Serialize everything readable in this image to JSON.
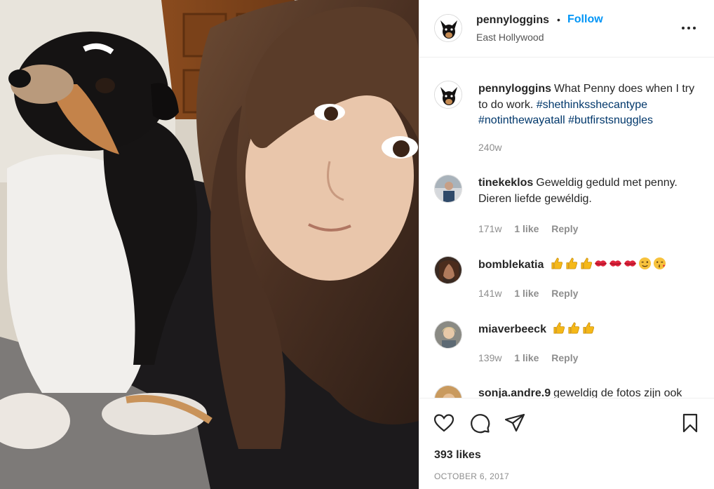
{
  "post": {
    "username": "pennyloggins",
    "follow_label": "Follow",
    "dot": "•",
    "location": "East Hollywood",
    "image_alt": "Selfie of a woman with long brown hair next to a black, tan and white dog",
    "caption": {
      "username": "pennyloggins",
      "text": "What Penny does when I try to do work.",
      "hashtags": [
        "#shethinksshecantype",
        "#notinthewayatall",
        "#butfirstsnuggles"
      ],
      "age": "240w"
    },
    "comments": [
      {
        "username": "tinekeklos",
        "text": "Geweldig geduld met penny. Dieren liefde gewéldig.",
        "age": "171w",
        "likes": "1 like",
        "reply": "Reply",
        "emojis": []
      },
      {
        "username": "bomblekatia",
        "text": "",
        "age": "141w",
        "likes": "1 like",
        "reply": "Reply",
        "emojis": [
          "thumbs-up",
          "thumbs-up",
          "thumbs-up",
          "kiss-lips",
          "kiss-lips",
          "kiss-lips",
          "wink-face",
          "kiss-face"
        ]
      },
      {
        "username": "miaverbeeck",
        "text": "",
        "age": "139w",
        "likes": "1 like",
        "reply": "Reply",
        "emojis": [
          "thumbs-up",
          "thumbs-up",
          "thumbs-up"
        ]
      },
      {
        "username": "sonja.andre.9",
        "text": "geweldig de fotos zijn ook",
        "age": "",
        "likes": "",
        "reply": "",
        "emojis": []
      }
    ],
    "likes": "393 likes",
    "date": "OCTOBER 6, 2017",
    "icons": [
      "heart-icon",
      "comment-icon",
      "share-icon",
      "bookmark-icon",
      "more-icon"
    ],
    "colors": {
      "accent": "#0095f6",
      "text": "#262626",
      "muted": "#8e8e8e",
      "hashtag": "#00376b"
    }
  }
}
